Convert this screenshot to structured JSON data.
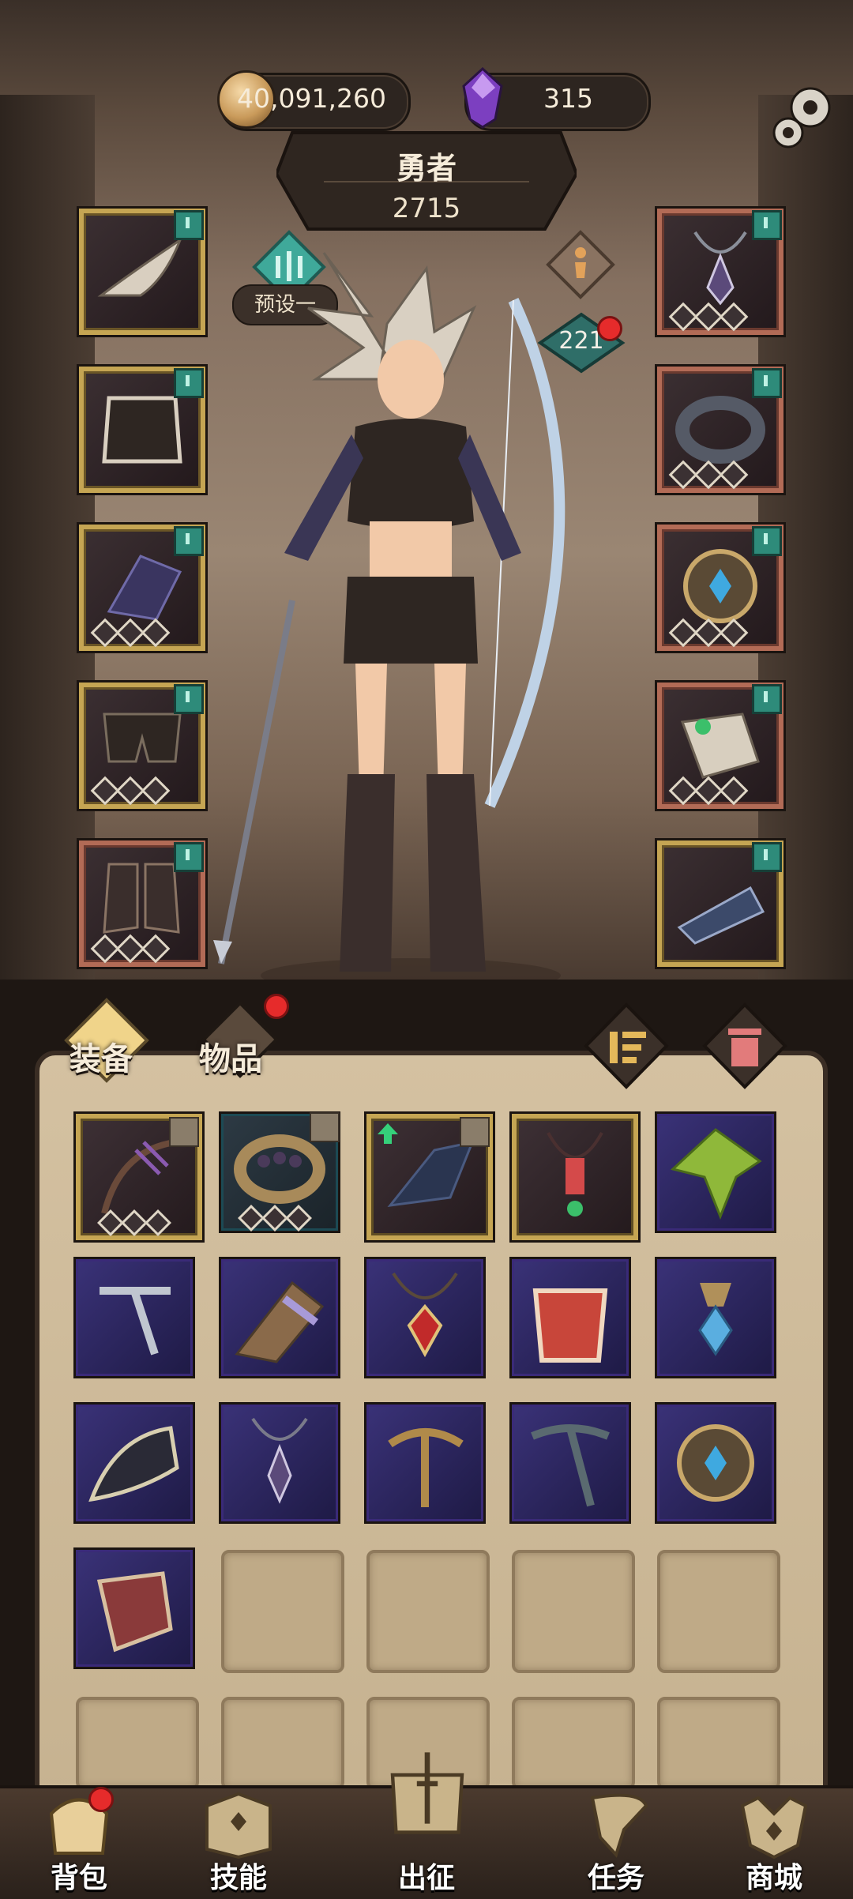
{
  "currency": {
    "coins": "40,091,260",
    "gems": "315"
  },
  "hero": {
    "title": "勇者",
    "power": "2715",
    "level": "221"
  },
  "preset": {
    "label": "预设一"
  },
  "tabs": {
    "equipment": "装备",
    "items": "物品"
  },
  "nav": {
    "bag": "背包",
    "skills": "技能",
    "expedition": "出征",
    "quests": "任务",
    "shop": "商城"
  },
  "colors": {
    "gold_frame": "#c5a553",
    "epic_frame": "#b38bd9",
    "rare_frame": "#6fb6b9",
    "red_dot": "#e62b2b",
    "teal_tag": "#2e8b7a"
  }
}
